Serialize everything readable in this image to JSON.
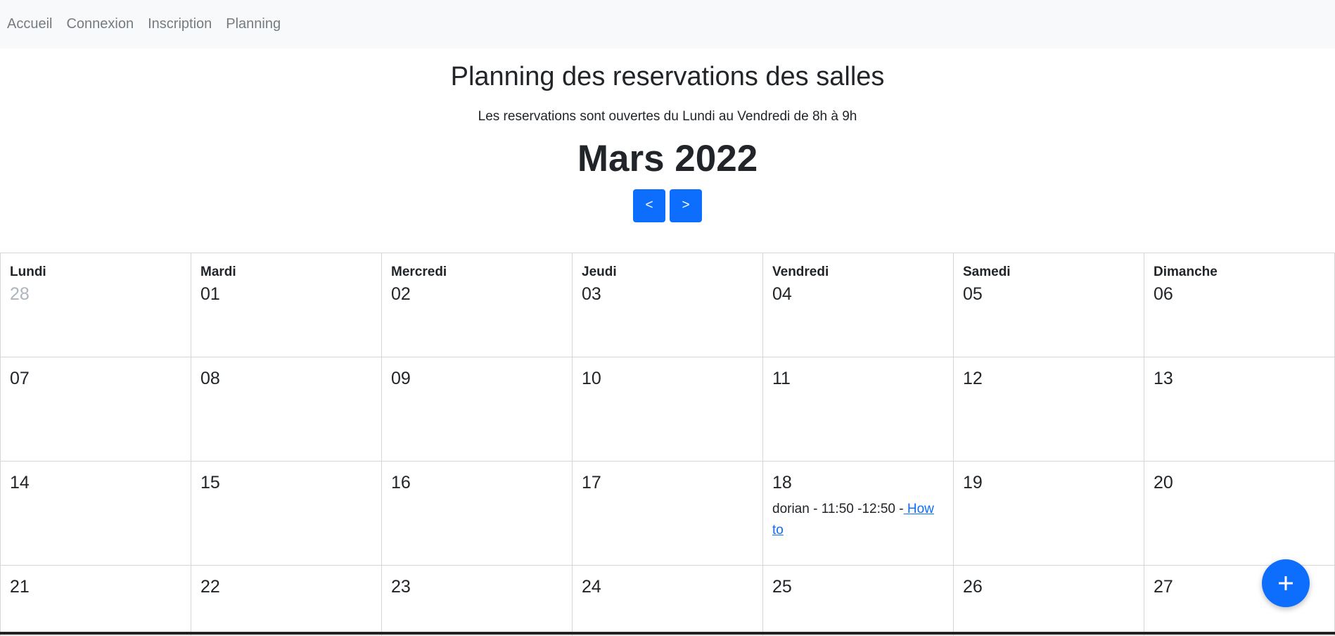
{
  "nav": {
    "items": [
      {
        "label": "Accueil"
      },
      {
        "label": "Connexion"
      },
      {
        "label": "Inscription"
      },
      {
        "label": "Planning"
      }
    ]
  },
  "header": {
    "title": "Planning des reservations des salles",
    "subtitle": "Les reservations sont ouvertes du Lundi au Vendredi de 8h à 9h",
    "month": "Mars 2022",
    "prev_label": "<",
    "next_label": ">"
  },
  "calendar": {
    "weekdays": [
      "Lundi",
      "Mardi",
      "Mercredi",
      "Jeudi",
      "Vendredi",
      "Samedi",
      "Dimanche"
    ],
    "weeks": [
      {
        "days": [
          {
            "num": "28",
            "other": true
          },
          {
            "num": "01"
          },
          {
            "num": "02"
          },
          {
            "num": "03"
          },
          {
            "num": "04"
          },
          {
            "num": "05"
          },
          {
            "num": "06"
          }
        ]
      },
      {
        "days": [
          {
            "num": "07"
          },
          {
            "num": "08"
          },
          {
            "num": "09"
          },
          {
            "num": "10"
          },
          {
            "num": "11"
          },
          {
            "num": "12"
          },
          {
            "num": "13"
          }
        ]
      },
      {
        "days": [
          {
            "num": "14"
          },
          {
            "num": "15"
          },
          {
            "num": "16"
          },
          {
            "num": "17"
          },
          {
            "num": "18",
            "event": {
              "text": "dorian - 11:50 -12:50 -",
              "link": " How to"
            }
          },
          {
            "num": "19"
          },
          {
            "num": "20"
          }
        ]
      },
      {
        "days": [
          {
            "num": "21"
          },
          {
            "num": "22"
          },
          {
            "num": "23"
          },
          {
            "num": "24"
          },
          {
            "num": "25"
          },
          {
            "num": "26"
          },
          {
            "num": "27"
          }
        ]
      }
    ]
  },
  "fab": {
    "icon": "plus-icon",
    "color": "#0d6efd"
  },
  "colors": {
    "primary": "#0d6efd",
    "navbar_bg": "#f8f9fa",
    "nav_text": "#767b80",
    "other_month_text": "#adb5bd"
  }
}
